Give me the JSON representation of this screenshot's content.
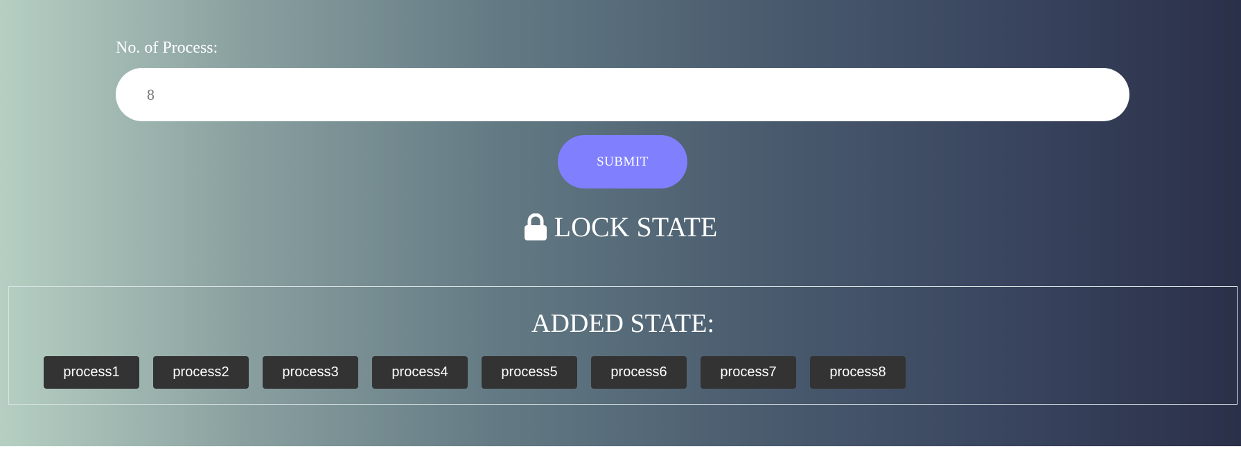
{
  "form": {
    "label": "No. of Process:",
    "input_value": "8",
    "submit_label": "SUBMIT"
  },
  "lock_state": {
    "icon": "lock-icon",
    "title": "LOCK STATE"
  },
  "added_state": {
    "title": "ADDED STATE:",
    "processes": [
      "process1",
      "process2",
      "process3",
      "process4",
      "process5",
      "process6",
      "process7",
      "process8"
    ]
  },
  "colors": {
    "submit_button": "#8080ff",
    "process_button": "#333333",
    "gradient_left": "#b6cfc2",
    "gradient_right": "#2b3049"
  }
}
